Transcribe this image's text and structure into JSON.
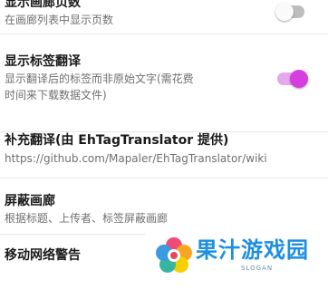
{
  "settings": [
    {
      "title": "显示画廊页数",
      "subtitle": "在画廊列表中显示页数",
      "toggle": false
    },
    {
      "title": "显示标签翻译",
      "subtitle_line1": "显示翻译后的标签而非原始文字(需花费",
      "subtitle_line2": "时间来下载数据文件)",
      "toggle": true
    },
    {
      "title": "补充翻译(由 EhTagTranslator 提供)",
      "subtitle": "https://github.com/Mapaler/EhTagTranslator/wiki"
    },
    {
      "title": "屏蔽画廊",
      "subtitle": "根据标题、上传者、标签屏蔽画廊"
    },
    {
      "title": "移动网络警告"
    }
  ],
  "watermark": {
    "name": "果汁游戏园",
    "slogan": "SLOGAN"
  },
  "colors": {
    "accent": "#d63ee0",
    "accent_track": "#e7a7ee",
    "watermark_blue": "#1e8fe0"
  }
}
